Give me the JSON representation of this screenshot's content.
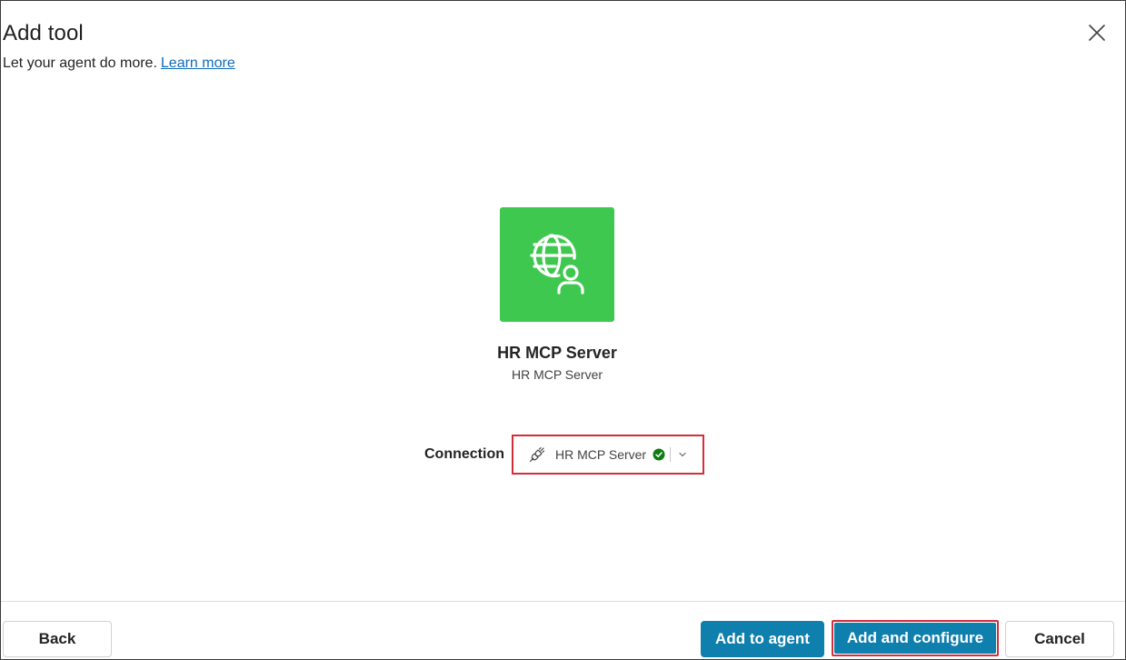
{
  "dialog": {
    "title": "Add tool",
    "subtitle": "Let your agent do more.",
    "learn_more": "Learn more"
  },
  "tool": {
    "icon": "globe-person-icon",
    "name": "HR MCP Server",
    "description": "HR MCP Server",
    "icon_bg": "#3fc84f"
  },
  "connection": {
    "label": "Connection",
    "selected": "HR MCP Server",
    "status": "connected",
    "status_color": "#107c10"
  },
  "footer": {
    "back_label": "Back",
    "add_to_agent_label": "Add to agent",
    "add_and_configure_label": "Add and configure",
    "cancel_label": "Cancel"
  },
  "colors": {
    "primary": "#0f7fad",
    "highlight": "#d32f3a",
    "link": "#0f6cbd"
  }
}
